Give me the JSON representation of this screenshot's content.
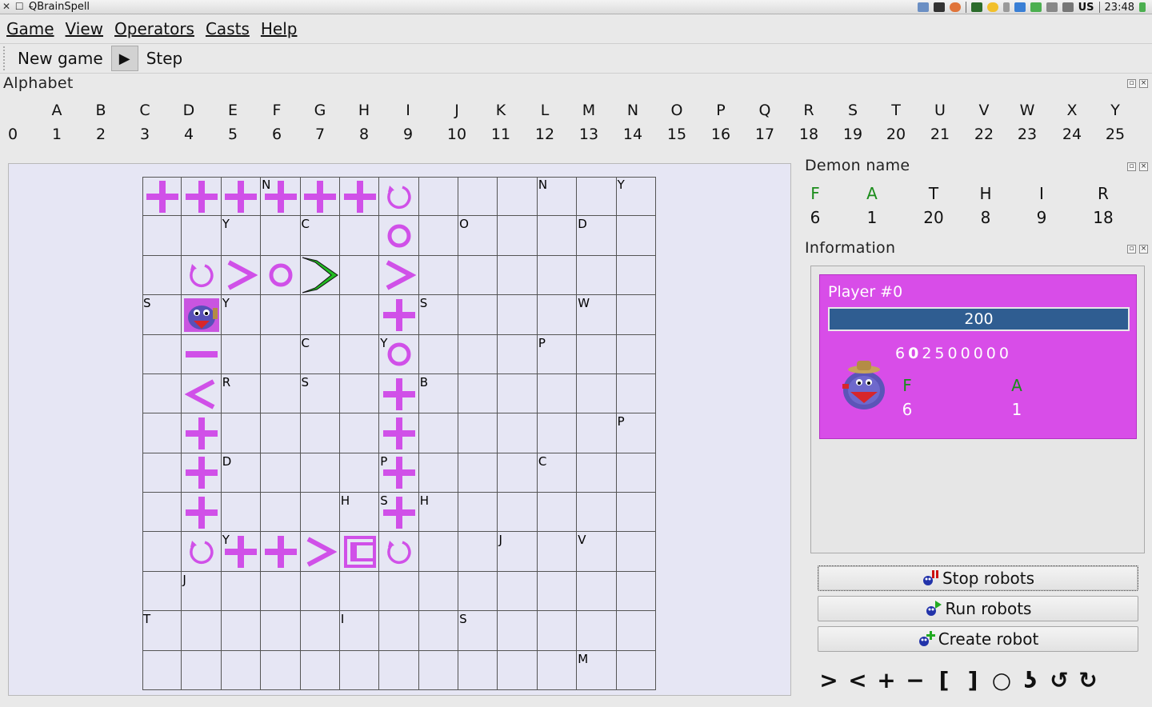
{
  "window": {
    "title": "QBrainSpell"
  },
  "tray": {
    "keyboard_layout": "US",
    "clock": "23:48"
  },
  "menu": [
    "Game",
    "View",
    "Operators",
    "Casts",
    "Help"
  ],
  "toolbar": {
    "new_game": "New game",
    "play_icon": "▶",
    "step": "Step"
  },
  "alphabet": {
    "title": "Alphabet",
    "letters": [
      "",
      "A",
      "B",
      "C",
      "D",
      "E",
      "F",
      "G",
      "H",
      "I",
      "J",
      "K",
      "L",
      "M",
      "N",
      "O",
      "P",
      "Q",
      "R",
      "S",
      "T",
      "U",
      "V",
      "W",
      "X",
      "Y"
    ],
    "numbers": [
      "0",
      "1",
      "2",
      "3",
      "4",
      "5",
      "6",
      "7",
      "8",
      "9",
      "10",
      "11",
      "12",
      "13",
      "14",
      "15",
      "16",
      "17",
      "18",
      "19",
      "20",
      "21",
      "22",
      "23",
      "24",
      "25"
    ]
  },
  "board": {
    "cols": 13,
    "rows": 13,
    "operator_color": "#d050e8",
    "letters": [
      {
        "r": 0,
        "c": 3,
        "t": "N"
      },
      {
        "r": 0,
        "c": 10,
        "t": "N"
      },
      {
        "r": 0,
        "c": 12,
        "t": "Y"
      },
      {
        "r": 1,
        "c": 2,
        "t": "Y"
      },
      {
        "r": 1,
        "c": 4,
        "t": "C"
      },
      {
        "r": 1,
        "c": 8,
        "t": "O"
      },
      {
        "r": 1,
        "c": 11,
        "t": "D"
      },
      {
        "r": 3,
        "c": 0,
        "t": "S"
      },
      {
        "r": 3,
        "c": 2,
        "t": "Y"
      },
      {
        "r": 3,
        "c": 7,
        "t": "S"
      },
      {
        "r": 3,
        "c": 11,
        "t": "W"
      },
      {
        "r": 4,
        "c": 4,
        "t": "C"
      },
      {
        "r": 4,
        "c": 6,
        "t": "Y"
      },
      {
        "r": 4,
        "c": 10,
        "t": "P"
      },
      {
        "r": 5,
        "c": 2,
        "t": "R"
      },
      {
        "r": 5,
        "c": 4,
        "t": "S"
      },
      {
        "r": 5,
        "c": 7,
        "t": "B"
      },
      {
        "r": 6,
        "c": 12,
        "t": "P"
      },
      {
        "r": 7,
        "c": 2,
        "t": "D"
      },
      {
        "r": 7,
        "c": 6,
        "t": "P"
      },
      {
        "r": 7,
        "c": 10,
        "t": "C"
      },
      {
        "r": 8,
        "c": 5,
        "t": "H"
      },
      {
        "r": 8,
        "c": 6,
        "t": "S"
      },
      {
        "r": 8,
        "c": 7,
        "t": "H"
      },
      {
        "r": 9,
        "c": 2,
        "t": "Y"
      },
      {
        "r": 9,
        "c": 9,
        "t": "J"
      },
      {
        "r": 9,
        "c": 11,
        "t": "V"
      },
      {
        "r": 10,
        "c": 1,
        "t": "J"
      },
      {
        "r": 11,
        "c": 0,
        "t": "T"
      },
      {
        "r": 11,
        "c": 5,
        "t": "I"
      },
      {
        "r": 11,
        "c": 8,
        "t": "S"
      },
      {
        "r": 12,
        "c": 11,
        "t": "M"
      }
    ],
    "operators": [
      {
        "r": 0,
        "c": 0,
        "op": "plus"
      },
      {
        "r": 0,
        "c": 1,
        "op": "plus"
      },
      {
        "r": 0,
        "c": 2,
        "op": "plus"
      },
      {
        "r": 0,
        "c": 3,
        "op": "plus"
      },
      {
        "r": 0,
        "c": 4,
        "op": "plus"
      },
      {
        "r": 0,
        "c": 5,
        "op": "plus"
      },
      {
        "r": 0,
        "c": 6,
        "op": "rotate"
      },
      {
        "r": 1,
        "c": 6,
        "op": "circle"
      },
      {
        "r": 2,
        "c": 1,
        "op": "rotate"
      },
      {
        "r": 2,
        "c": 2,
        "op": "gt"
      },
      {
        "r": 2,
        "c": 3,
        "op": "circle"
      },
      {
        "r": 2,
        "c": 4,
        "op": "gt-green"
      },
      {
        "r": 2,
        "c": 6,
        "op": "gt"
      },
      {
        "r": 3,
        "c": 6,
        "op": "plus"
      },
      {
        "r": 4,
        "c": 1,
        "op": "minus"
      },
      {
        "r": 4,
        "c": 6,
        "op": "circle"
      },
      {
        "r": 5,
        "c": 1,
        "op": "lt"
      },
      {
        "r": 5,
        "c": 6,
        "op": "plus"
      },
      {
        "r": 6,
        "c": 1,
        "op": "plus"
      },
      {
        "r": 6,
        "c": 6,
        "op": "plus"
      },
      {
        "r": 7,
        "c": 1,
        "op": "plus"
      },
      {
        "r": 7,
        "c": 6,
        "op": "plus"
      },
      {
        "r": 8,
        "c": 1,
        "op": "plus"
      },
      {
        "r": 8,
        "c": 6,
        "op": "plus"
      },
      {
        "r": 9,
        "c": 1,
        "op": "rotate"
      },
      {
        "r": 9,
        "c": 2,
        "op": "plus"
      },
      {
        "r": 9,
        "c": 3,
        "op": "plus"
      },
      {
        "r": 9,
        "c": 4,
        "op": "gt"
      },
      {
        "r": 9,
        "c": 5,
        "op": "bracket"
      },
      {
        "r": 9,
        "c": 6,
        "op": "rotate"
      }
    ],
    "robot": {
      "r": 3,
      "c": 1
    }
  },
  "demon": {
    "title": "Demon name",
    "letters": [
      "F",
      "A",
      "T",
      "H",
      "I",
      "R"
    ],
    "numbers": [
      "6",
      "1",
      "20",
      "8",
      "9",
      "18"
    ],
    "matched_color": "#1a8c1a",
    "matched_count": 2
  },
  "information": {
    "title": "Information",
    "player_name": "Player #0",
    "score": "200",
    "digits": [
      "6",
      "0",
      "25",
      "0",
      "0",
      "0",
      "0",
      "0"
    ],
    "bold_digit_index": 1,
    "letters": [
      "F",
      "A"
    ],
    "numbers": [
      "6",
      "1"
    ],
    "card_color": "#d84de8"
  },
  "buttons": {
    "stop": "Stop robots",
    "run": "Run robots",
    "create": "Create robot"
  },
  "palette": [
    {
      "icon": "gt-icon",
      "glyph": ">"
    },
    {
      "icon": "lt-icon",
      "glyph": "<"
    },
    {
      "icon": "plus-icon",
      "glyph": "+"
    },
    {
      "icon": "minus-icon",
      "glyph": "−"
    },
    {
      "icon": "left-bracket-icon",
      "glyph": "["
    },
    {
      "icon": "right-bracket-icon",
      "glyph": "]"
    },
    {
      "icon": "circle-icon",
      "glyph": "○"
    },
    {
      "icon": "hook-icon",
      "glyph": "ʖ"
    },
    {
      "icon": "rotate-ccw-icon",
      "glyph": "↺"
    },
    {
      "icon": "rotate-cw-icon",
      "glyph": "↻"
    }
  ]
}
